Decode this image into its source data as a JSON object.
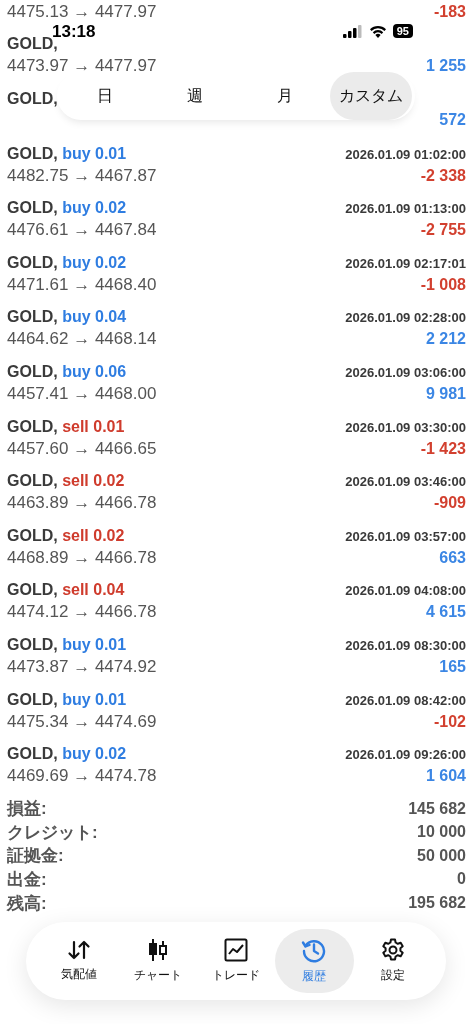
{
  "status_bar": {
    "time": "13:18",
    "battery": "95"
  },
  "period_tabs": [
    {
      "label": "日",
      "selected": false
    },
    {
      "label": "週",
      "selected": false
    },
    {
      "label": "月",
      "selected": false
    },
    {
      "label": "カスタム",
      "selected": true
    }
  ],
  "deals": [
    {
      "prices": "4475.13 → 4477.97",
      "profit": "-183",
      "loss": true
    },
    {
      "symbol": "GOLD,",
      "prices": "4473.97 → 4477.97",
      "profit": "1 255",
      "loss": false
    },
    {
      "symbol": "GOLD,",
      "profit": "572",
      "loss": false
    },
    {
      "symbol": "GOLD,",
      "side": "buy",
      "kind": "buy",
      "volume": "0.01",
      "time": "2026.01.09 01:02:00",
      "prices": "4482.75 → 4467.87",
      "profit": "-2 338",
      "loss": true
    },
    {
      "symbol": "GOLD,",
      "side": "buy",
      "kind": "buy",
      "volume": "0.02",
      "time": "2026.01.09 01:13:00",
      "prices": "4476.61 → 4467.84",
      "profit": "-2 755",
      "loss": true
    },
    {
      "symbol": "GOLD,",
      "side": "buy",
      "kind": "buy",
      "volume": "0.02",
      "time": "2026.01.09 02:17:01",
      "prices": "4471.61 → 4468.40",
      "profit": "-1 008",
      "loss": true
    },
    {
      "symbol": "GOLD,",
      "side": "buy",
      "kind": "buy",
      "volume": "0.04",
      "time": "2026.01.09 02:28:00",
      "prices": "4464.62 → 4468.14",
      "profit": "2 212",
      "loss": false
    },
    {
      "symbol": "GOLD,",
      "side": "buy",
      "kind": "buy",
      "volume": "0.06",
      "time": "2026.01.09 03:06:00",
      "prices": "4457.41 → 4468.00",
      "profit": "9 981",
      "loss": false
    },
    {
      "symbol": "GOLD,",
      "side": "sell",
      "kind": "sell",
      "volume": "0.01",
      "time": "2026.01.09 03:30:00",
      "prices": "4457.60 → 4466.65",
      "profit": "-1 423",
      "loss": true
    },
    {
      "symbol": "GOLD,",
      "side": "sell",
      "kind": "sell",
      "volume": "0.02",
      "time": "2026.01.09 03:46:00",
      "prices": "4463.89 → 4466.78",
      "profit": "-909",
      "loss": true
    },
    {
      "symbol": "GOLD,",
      "side": "sell",
      "kind": "sell",
      "volume": "0.02",
      "time": "2026.01.09 03:57:00",
      "prices": "4468.89 → 4466.78",
      "profit": "663",
      "loss": false
    },
    {
      "symbol": "GOLD,",
      "side": "sell",
      "kind": "sell",
      "volume": "0.04",
      "time": "2026.01.09 04:08:00",
      "prices": "4474.12 → 4466.78",
      "profit": "4 615",
      "loss": false
    },
    {
      "symbol": "GOLD,",
      "side": "buy",
      "kind": "buy",
      "volume": "0.01",
      "time": "2026.01.09 08:30:00",
      "prices": "4473.87 → 4474.92",
      "profit": "165",
      "loss": false
    },
    {
      "symbol": "GOLD,",
      "side": "buy",
      "kind": "buy",
      "volume": "0.01",
      "time": "2026.01.09 08:42:00",
      "prices": "4475.34 → 4474.69",
      "profit": "-102",
      "loss": true
    },
    {
      "symbol": "GOLD,",
      "side": "buy",
      "kind": "buy",
      "volume": "0.02",
      "time": "2026.01.09 09:26:00",
      "prices": "4469.69 → 4474.78",
      "profit": "1 604",
      "loss": false
    }
  ],
  "summary": [
    {
      "label": "損益:",
      "value": "145 682"
    },
    {
      "label": "クレジット:",
      "value": "10 000"
    },
    {
      "label": "証拠金:",
      "value": "50 000"
    },
    {
      "label": "出金:",
      "value": "0"
    },
    {
      "label": "残高:",
      "value": "195 682"
    }
  ],
  "tab_bar": [
    {
      "label": "気配値",
      "kind": "quotes",
      "selected": false
    },
    {
      "label": "チャート",
      "kind": "chart",
      "selected": false
    },
    {
      "label": "トレード",
      "kind": "trade",
      "selected": false
    },
    {
      "label": "履歴",
      "kind": "history",
      "selected": true
    },
    {
      "label": "設定",
      "kind": "settings",
      "selected": false
    }
  ]
}
